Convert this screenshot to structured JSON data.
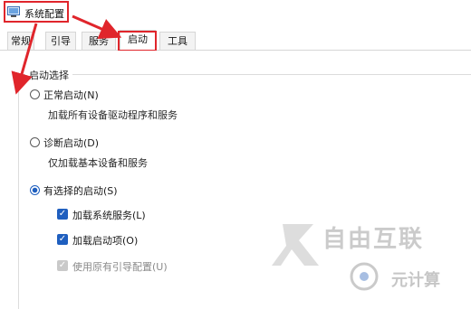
{
  "window": {
    "title": "系统配置"
  },
  "tabs": [
    {
      "label": "常规"
    },
    {
      "label": "引导"
    },
    {
      "label": "服务"
    },
    {
      "label": "启动"
    },
    {
      "label": "工具"
    }
  ],
  "active_tab": "启动",
  "startup_selection": {
    "group_label": "启动选择",
    "options": [
      {
        "label": "正常启动(N)",
        "description": "加载所有设备驱动程序和服务",
        "selected": false
      },
      {
        "label": "诊断启动(D)",
        "description": "仅加载基本设备和服务",
        "selected": false
      },
      {
        "label": "有选择的启动(S)",
        "selected": true
      }
    ],
    "checkboxes": [
      {
        "label": "加载系统服务(L)",
        "checked": true,
        "enabled": true
      },
      {
        "label": "加载启动项(O)",
        "checked": true,
        "enabled": true
      },
      {
        "label": "使用原有引导配置(U)",
        "checked": true,
        "enabled": false
      }
    ]
  },
  "watermark": {
    "text": "自由互联",
    "text2": "元计算"
  },
  "colors": {
    "highlight": "#e0252b",
    "accent": "#1f5fbf"
  }
}
